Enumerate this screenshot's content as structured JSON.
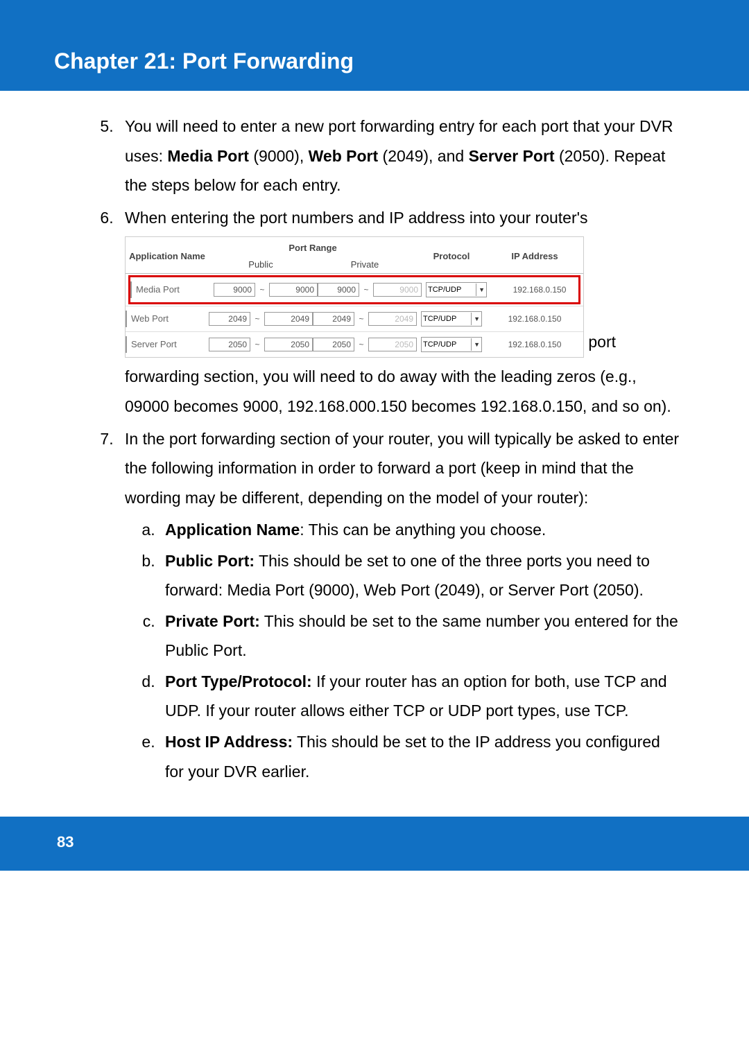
{
  "header": {
    "title": "Chapter 21: Port Forwarding"
  },
  "list": {
    "start": 5,
    "items": [
      {
        "pre": "You will need to enter a new port forwarding entry for each port that your DVR uses: ",
        "b1": "Media Port",
        "t1": " (9000), ",
        "b2": "Web Port",
        "t2": " (2049), and ",
        "b3": "Server Port",
        "t3": " (2050). Repeat the steps below for each entry."
      },
      {
        "pre2a": "When entering the port numbers and IP address into your router's",
        "pre2b": " port forwarding section, you will need to do away with the leading zeros (e.g., 09000 becomes 9000, 192.168.000.150 becomes 192.168.0.150, and so on)."
      },
      {
        "text": "In the port forwarding section of your router, you will typically be asked to enter the following information in order to forward a port (keep in mind that the wording may be different, depending on the model of your router):"
      }
    ],
    "sub": [
      {
        "b": "Application Name",
        "t": ": This can be anything you choose."
      },
      {
        "b": "Public Port:",
        "t": " This should be set to one of the three ports you need to forward: Media Port (9000), Web Port (2049), or Server Port (2050)."
      },
      {
        "b": "Private Port:",
        "t": " This should be set to the same number you entered for the Public Port."
      },
      {
        "b": "Port Type/Protocol:",
        "t": " If your router has an option for both, use TCP and UDP. If your router allows either TCP or UDP port types, use TCP."
      },
      {
        "b": "Host IP Address:",
        "t": " This should be set to the IP address you configured for your DVR earlier."
      }
    ]
  },
  "router_table": {
    "headers": {
      "app": "Application Name",
      "range": "Port Range",
      "public": "Public",
      "private": "Private",
      "protocol": "Protocol",
      "ip": "IP Address"
    },
    "rows": [
      {
        "name": "Media Port",
        "pub1": "9000",
        "pub2": "9000",
        "priv1": "9000",
        "priv2": "9000",
        "proto": "TCP/UDP",
        "ip": "192.168.0.150"
      },
      {
        "name": "Web Port",
        "pub1": "2049",
        "pub2": "2049",
        "priv1": "2049",
        "priv2": "2049",
        "proto": "TCP/UDP",
        "ip": "192.168.0.150"
      },
      {
        "name": "Server Port",
        "pub1": "2050",
        "pub2": "2050",
        "priv1": "2050",
        "priv2": "2050",
        "proto": "TCP/UDP",
        "ip": "192.168.0.150"
      }
    ]
  },
  "footer": {
    "page": "83"
  }
}
